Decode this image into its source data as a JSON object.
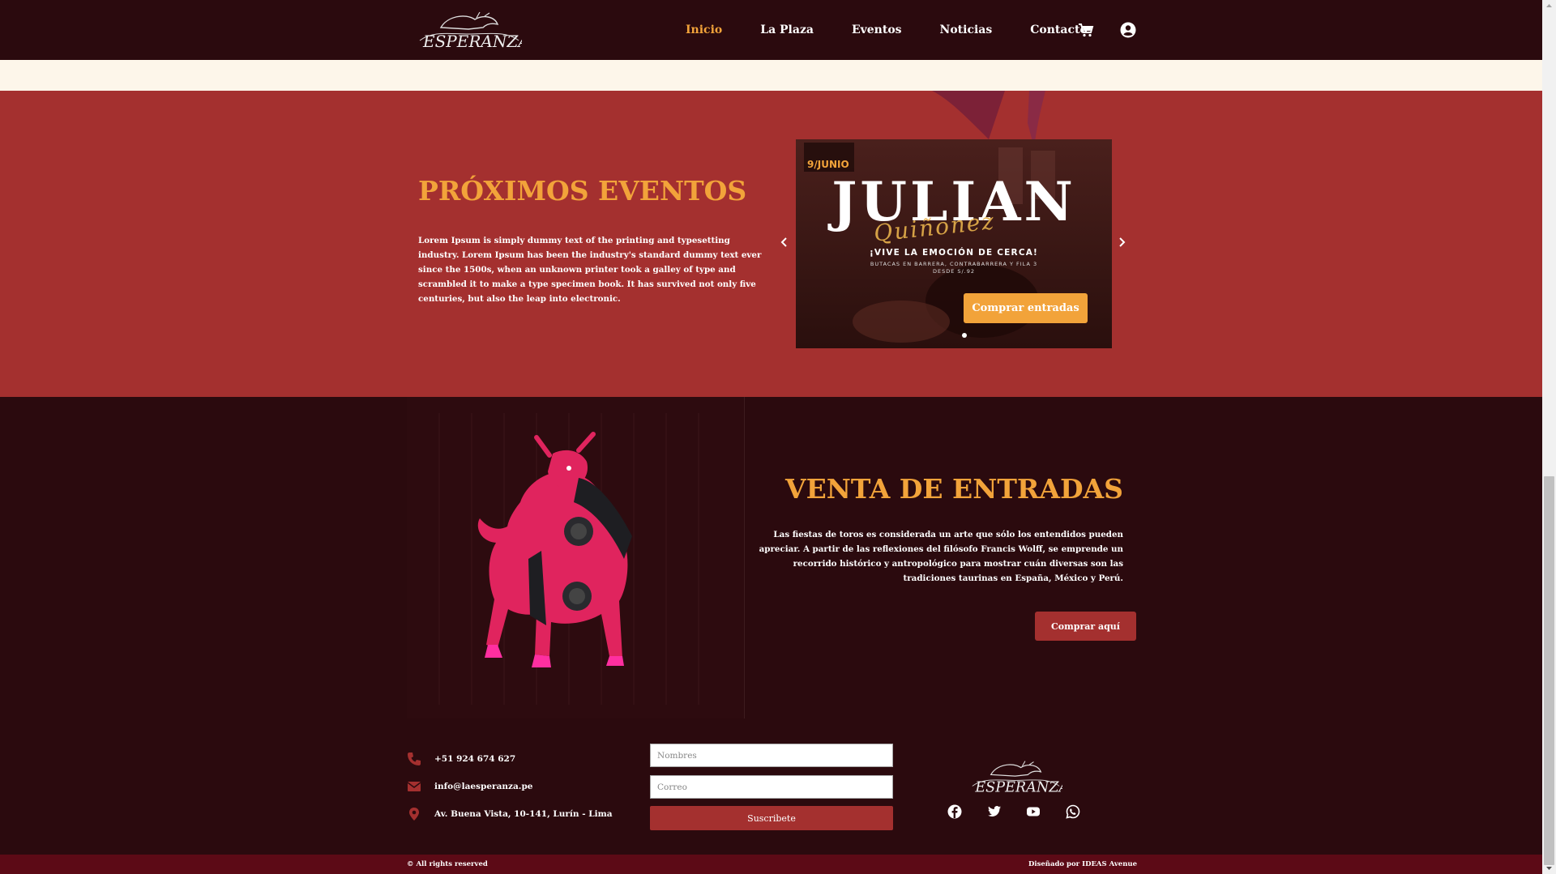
{
  "header": {
    "nav": [
      {
        "label": "Inicio",
        "active": true
      },
      {
        "label": "La Plaza"
      },
      {
        "label": "Eventos"
      },
      {
        "label": "Noticias"
      },
      {
        "label": "Contacto"
      }
    ],
    "cart_icon": "cart-icon",
    "user_icon": "user-circle-icon"
  },
  "events": {
    "title": "PRÓXIMOS EVENTOS",
    "text": "Lorem Ipsum is simply dummy text of the printing and typesetting industry. Lorem Ipsum has been the industry's standard dummy text ever since the 1500s, when an unknown printer took a galley of type and scrambled it to make a type specimen book. It has survived not only five centuries, but also the leap into electronic.",
    "slide": {
      "date": "9/JUNIO",
      "title": "JULIAN",
      "script": "Quiñonez",
      "tagline": "¡VIVE LA EMOCIÓN DE CERCA!",
      "sub1": "BUTACAS EN BARRERA, CONTRABARRERA Y FILA 3",
      "sub2": "DESDE S/.92",
      "button": "Comprar entradas"
    }
  },
  "tickets": {
    "title": "VENTA DE ENTRADAS",
    "text": "Las fiestas de toros es considerada un arte que sólo los entendidos pueden apreciar. A partir de las reflexiones del filósofo Francis Wolff, se emprende un recorrido histórico y antropológico para mostrar cuán diversas son las tradiciones taurinas en España, México y Perú.",
    "button": "Comprar aquí"
  },
  "footer": {
    "phone": "+51 924 674 627",
    "email": "info@laesperanza.pe",
    "address": "Av. Buena Vista, 10-141, Lurín - Lima",
    "name_placeholder": "Nombres",
    "email_placeholder": "Correo",
    "subscribe": "Suscribete",
    "social": [
      "facebook-icon",
      "twitter-icon",
      "youtube-icon",
      "whatsapp-icon"
    ]
  },
  "bottom": {
    "rights": "© All rights reserved",
    "credit": "Diseñado por IDEAS Avenue"
  },
  "colors": {
    "accent": "#f2a33a",
    "dark": "#2b0a0e",
    "red": "#a4302f",
    "cream": "#fdf6ea"
  }
}
